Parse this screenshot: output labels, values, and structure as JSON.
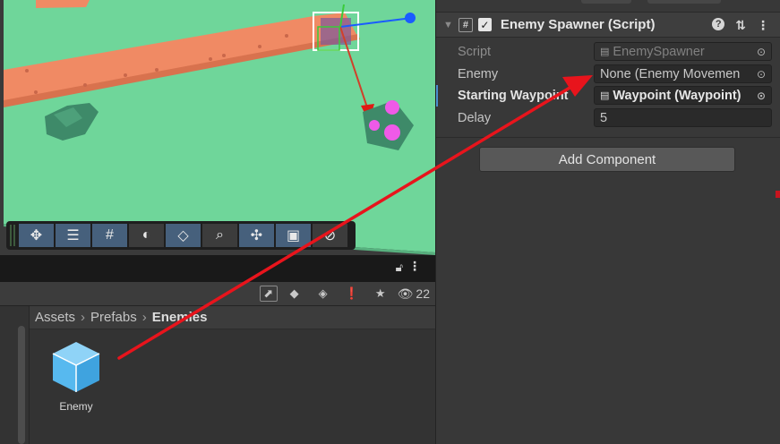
{
  "scene": {
    "toolbar_icons": [
      "move-tool-icon",
      "rect-transform-icon",
      "grid-snap-icon",
      "shading-icon",
      "layers-icon",
      "search-icon",
      "gizmo-icon",
      "camera-icon",
      "visibility-icon"
    ]
  },
  "scene_bar": {
    "lock_icon": "lock-icon",
    "menu_icon": "kebab-menu-icon"
  },
  "project": {
    "visibility_count": "22",
    "breadcrumb": [
      "Assets",
      "Prefabs",
      "Enemies"
    ],
    "assets": [
      {
        "label": "Enemy",
        "icon": "prefab-cube-icon"
      }
    ]
  },
  "inspector": {
    "component_title": "Enemy Spawner (Script)",
    "enabled": true,
    "properties": [
      {
        "label": "Script",
        "value": "EnemySpawner"
      },
      {
        "label": "Enemy",
        "value": "None (Enemy Movemen"
      },
      {
        "label": "Starting Waypoint",
        "value": "Waypoint (Waypoint)"
      },
      {
        "label": "Delay",
        "value": "5"
      }
    ],
    "add_component_label": "Add Component"
  },
  "colors": {
    "annotation_arrow": "#e8141c",
    "ground": "#6fd69a",
    "path": "#f08a64",
    "prefab_icon": "#57b9ef"
  }
}
